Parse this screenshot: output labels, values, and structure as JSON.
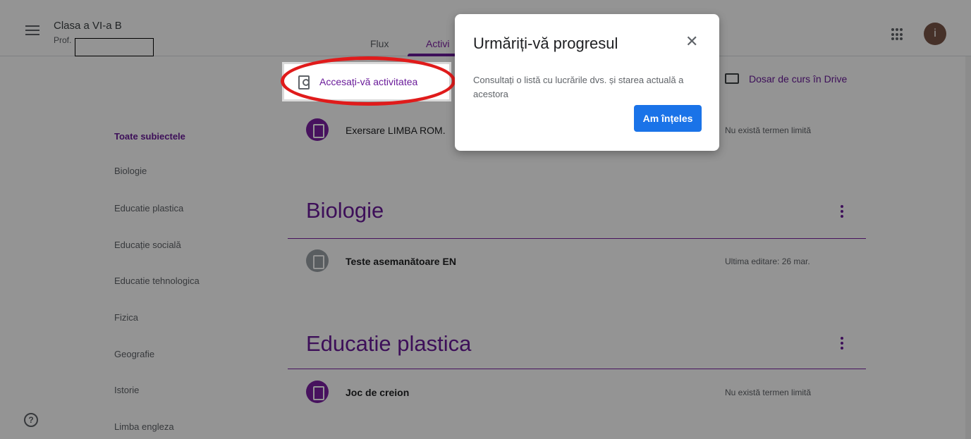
{
  "header": {
    "class_title": "Clasa a VI-a B",
    "class_subtitle": "Prof.",
    "tabs": [
      {
        "label": "Flux"
      },
      {
        "label": "Activi"
      }
    ],
    "avatar_letter": "i"
  },
  "sidebar": {
    "items": [
      {
        "label": "Toate subiectele"
      },
      {
        "label": "Biologie"
      },
      {
        "label": "Educatie plastica"
      },
      {
        "label": "Educație socială"
      },
      {
        "label": "Educatie tehnologica"
      },
      {
        "label": "Fizica"
      },
      {
        "label": "Geografie"
      },
      {
        "label": "Istorie"
      },
      {
        "label": "Limba engleza"
      }
    ]
  },
  "main": {
    "access_button_label": "Accesați-vă activitatea",
    "drive_button_label": "Dosar de curs în Drive",
    "rows": [
      {
        "title": "Exersare LIMBA ROM.",
        "meta": "Nu există termen limită"
      },
      {
        "title": "Teste asemanătoare EN",
        "meta": "Ultima editare: 26 mar."
      },
      {
        "title": "Joc de creion",
        "meta": "Nu există termen limită"
      }
    ],
    "sections": [
      {
        "title": "Biologie"
      },
      {
        "title": "Educatie plastica"
      }
    ]
  },
  "dialog": {
    "title": "Urmăriți-vă progresul",
    "text": "Consultați o listă cu lucrările dvs. și starea actuală a acestora",
    "button_label": "Am înțeles",
    "close_glyph": "✕"
  },
  "help_glyph": "?",
  "colors": {
    "accent": "#6a1b9a",
    "dialog_button": "#1a73e8",
    "highlight": "#e01b1b"
  }
}
